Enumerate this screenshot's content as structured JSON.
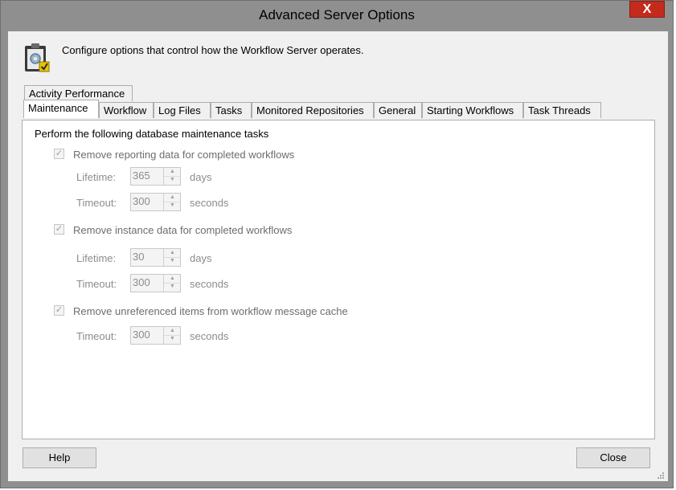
{
  "window": {
    "title": "Advanced Server Options",
    "close_glyph": "X"
  },
  "header": {
    "icon": "settings-clipboard-icon",
    "description": "Configure options that control how the Workflow Server operates."
  },
  "tabs": {
    "row1": [
      "Activity Performance"
    ],
    "row2": [
      "Maintenance",
      "Workflow",
      "Log Files",
      "Tasks",
      "Monitored Repositories",
      "General",
      "Starting Workflows",
      "Task Threads"
    ],
    "selected": "Maintenance"
  },
  "maintenance": {
    "title": "Perform the following database maintenance tasks",
    "reporting": {
      "label": "Remove reporting data for completed workflows",
      "checked": true,
      "lifetime_label": "Lifetime:",
      "lifetime_value": "365",
      "lifetime_unit": "days",
      "timeout_label": "Timeout:",
      "timeout_value": "300",
      "timeout_unit": "seconds"
    },
    "instance": {
      "label": "Remove instance data for completed workflows",
      "checked": true,
      "lifetime_label": "Lifetime:",
      "lifetime_value": "30",
      "lifetime_unit": "days",
      "timeout_label": "Timeout:",
      "timeout_value": "300",
      "timeout_unit": "seconds"
    },
    "cache": {
      "label": "Remove unreferenced items from workflow message cache",
      "checked": true,
      "timeout_label": "Timeout:",
      "timeout_value": "300",
      "timeout_unit": "seconds"
    }
  },
  "buttons": {
    "help": "Help",
    "close": "Close"
  },
  "check_glyph": "✓",
  "spin_up_glyph": "▲",
  "spin_down_glyph": "▼"
}
